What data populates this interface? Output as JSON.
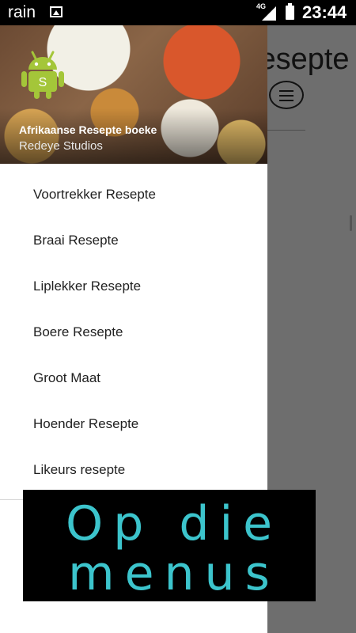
{
  "status_bar": {
    "carrier": "rain",
    "network": "4G",
    "time": "23:44",
    "icons": [
      "image-icon",
      "signal-icon",
      "battery-icon"
    ]
  },
  "background_app": {
    "title_fragment": "Resepte",
    "menu_icon": "hamburger-icon"
  },
  "drawer": {
    "header": {
      "title": "Afrikaanse Resepte boeke",
      "subtitle": "Redeye Studios",
      "logo_letter": "S",
      "logo_icon": "android-robot-icon",
      "logo_color": "#a4c639"
    },
    "items": [
      {
        "label": "Voortrekker Resepte"
      },
      {
        "label": "Braai Resepte"
      },
      {
        "label": "Liplekker Resepte"
      },
      {
        "label": "Boere Resepte"
      },
      {
        "label": "Groot Maat"
      },
      {
        "label": "Hoender Resepte"
      },
      {
        "label": "Likeurs resepte"
      }
    ]
  },
  "overlay": {
    "line1": "Op die",
    "line2": "menus",
    "color": "#3cc4cc"
  }
}
